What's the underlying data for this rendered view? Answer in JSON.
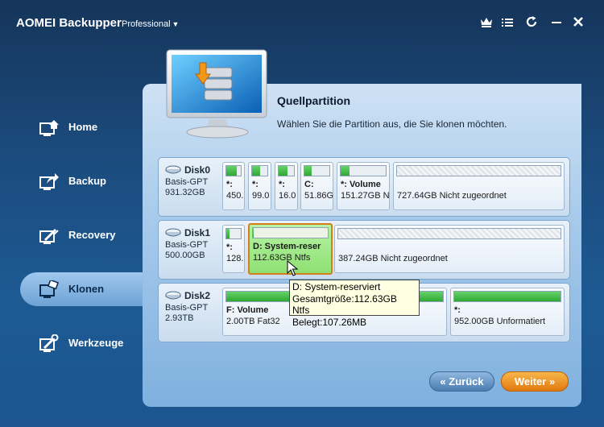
{
  "app": {
    "title": "AOMEI Backupper",
    "edition": "Professional"
  },
  "titlebar_icons": [
    "crown-icon",
    "menu-icon",
    "refresh-icon",
    "minimize-icon",
    "close-icon"
  ],
  "sidebar": {
    "items": [
      {
        "label": "Home",
        "icon": "home-icon"
      },
      {
        "label": "Backup",
        "icon": "backup-icon"
      },
      {
        "label": "Recovery",
        "icon": "recovery-icon"
      },
      {
        "label": "Klonen",
        "icon": "clone-icon",
        "active": true
      },
      {
        "label": "Werkzeuge",
        "icon": "tools-icon",
        "badge": true
      }
    ]
  },
  "main": {
    "heading": "Quellpartition",
    "subtitle": "Wählen Sie die Partition aus, die Sie klonen möchten."
  },
  "disks": [
    {
      "name": "Disk0",
      "type": "Basis-GPT",
      "size": "931.32GB",
      "partitions": [
        {
          "label": "*:",
          "size": "450.",
          "used": 0.7
        },
        {
          "label": "*:",
          "size": "99.0",
          "used": 0.5
        },
        {
          "label": "*:",
          "size": "16.0",
          "used": 0.6
        },
        {
          "label": "C:",
          "size": "51.86G",
          "used": 0.3
        },
        {
          "label": "*: Volume",
          "size": "151.27GB N",
          "used": 0.2
        },
        {
          "label": "",
          "size": "727.64GB Nicht zugeordnet",
          "unallocated": true
        }
      ]
    },
    {
      "name": "Disk1",
      "type": "Basis-GPT",
      "size": "500.00GB",
      "partitions": [
        {
          "label": "*:",
          "size": "128.",
          "used": 0.2
        },
        {
          "label": "D: System-reser",
          "size": "112.63GB Ntfs",
          "used": 0.01,
          "selected": true
        },
        {
          "label": "",
          "size": "387.24GB Nicht zugeordnet",
          "unallocated": true
        }
      ]
    },
    {
      "name": "Disk2",
      "type": "Basis-GPT",
      "size": "2.93TB",
      "partitions": [
        {
          "label": "F: Volume",
          "size": "2.00TB Fat32",
          "used": 0.01
        },
        {
          "label": "*:",
          "size": "952.00GB Unformatiert",
          "used": 0.01
        }
      ]
    }
  ],
  "tooltip": {
    "line1": "D: System-reserviert",
    "line2": "Gesamtgröße:112.63GB Ntfs",
    "line3": "Belegt:107.26MB"
  },
  "buttons": {
    "back": "Zurück",
    "next": "Weiter"
  },
  "colors": {
    "accent_orange": "#e07a0f",
    "selection_border": "#d47f1c",
    "used_fill": "#2ea833"
  }
}
